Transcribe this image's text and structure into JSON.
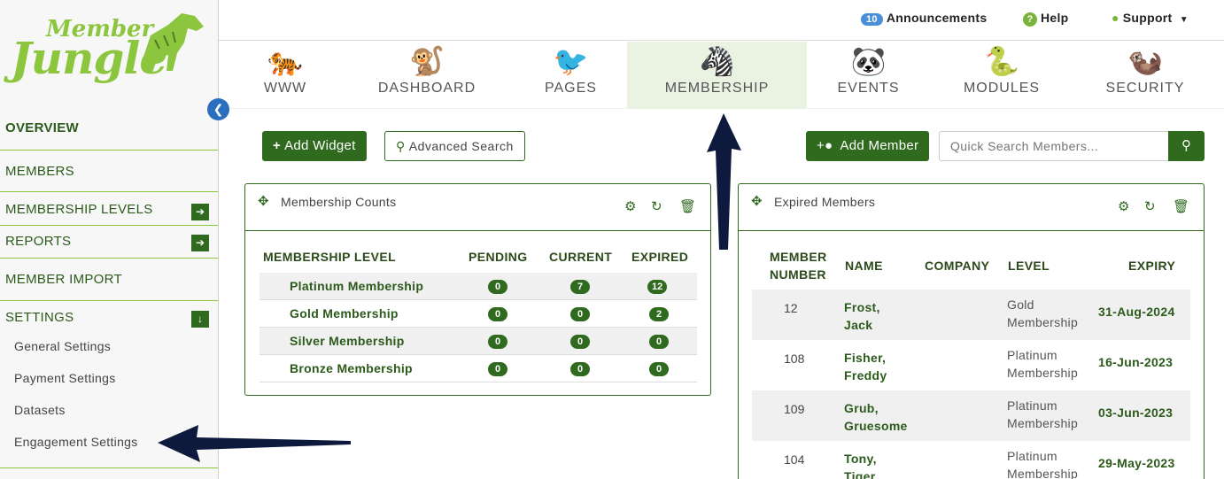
{
  "brand": {
    "line1": "Member",
    "line2": "Jungle"
  },
  "sidebar": {
    "overview": "OVERVIEW",
    "members": "MEMBERS",
    "membership_levels": "MEMBERSHIP LEVELS",
    "reports": "REPORTS",
    "member_import": "MEMBER IMPORT",
    "settings": "SETTINGS",
    "sub": [
      "General Settings",
      "Payment Settings",
      "Datasets",
      "Engagement Settings"
    ]
  },
  "topbar": {
    "announcements_count": "10",
    "announcements": "Announcements",
    "help": "Help",
    "support": "Support"
  },
  "tabs": [
    {
      "label": "WWW",
      "icon": "tiger-icon"
    },
    {
      "label": "DASHBOARD",
      "icon": "monkey-icon"
    },
    {
      "label": "PAGES",
      "icon": "toucan-icon"
    },
    {
      "label": "MEMBERSHIP",
      "icon": "zebra-icon"
    },
    {
      "label": "EVENTS",
      "icon": "panda-icon"
    },
    {
      "label": "MODULES",
      "icon": "snake-icon"
    },
    {
      "label": "SECURITY",
      "icon": "meerkat-icon"
    }
  ],
  "toolbar": {
    "add_widget": "Add Widget",
    "advanced_search": "Advanced Search",
    "add_member": "Add Member",
    "quick_search_placeholder": "Quick Search Members..."
  },
  "membership_counts": {
    "title": "Membership Counts",
    "headers": [
      "MEMBERSHIP LEVEL",
      "PENDING",
      "CURRENT",
      "EXPIRED"
    ],
    "rows": [
      {
        "level": "Platinum Membership",
        "pending": "0",
        "current": "7",
        "expired": "12"
      },
      {
        "level": "Gold Membership",
        "pending": "0",
        "current": "0",
        "expired": "2"
      },
      {
        "level": "Silver Membership",
        "pending": "0",
        "current": "0",
        "expired": "0"
      },
      {
        "level": "Bronze Membership",
        "pending": "0",
        "current": "0",
        "expired": "0"
      }
    ]
  },
  "expired_members": {
    "title": "Expired Members",
    "headers": {
      "member": "MEMBER",
      "number": "NUMBER",
      "name": "NAME",
      "company": "COMPANY",
      "level": "LEVEL",
      "expiry": "EXPIRY"
    },
    "rows": [
      {
        "number": "12",
        "last": "Frost,",
        "first": "Jack",
        "level1": "Gold",
        "level2": "Membership",
        "expiry": "31-Aug-2024"
      },
      {
        "number": "108",
        "last": "Fisher,",
        "first": "Freddy",
        "level1": "Platinum",
        "level2": "Membership",
        "expiry": "16-Jun-2023"
      },
      {
        "number": "109",
        "last": "Grub,",
        "first": "Gruesome",
        "level1": "Platinum",
        "level2": "Membership",
        "expiry": "03-Jun-2023"
      },
      {
        "number": "104",
        "last": "Tony,",
        "first": "Tiger",
        "level1": "Platinum",
        "level2": "Membership",
        "expiry": "29-May-2023"
      }
    ]
  },
  "colors": {
    "accent": "#2f6a1f",
    "brand_green": "#8cc63f",
    "arrow": "#0d1a3d",
    "active_tab": "#eaf3e2"
  }
}
